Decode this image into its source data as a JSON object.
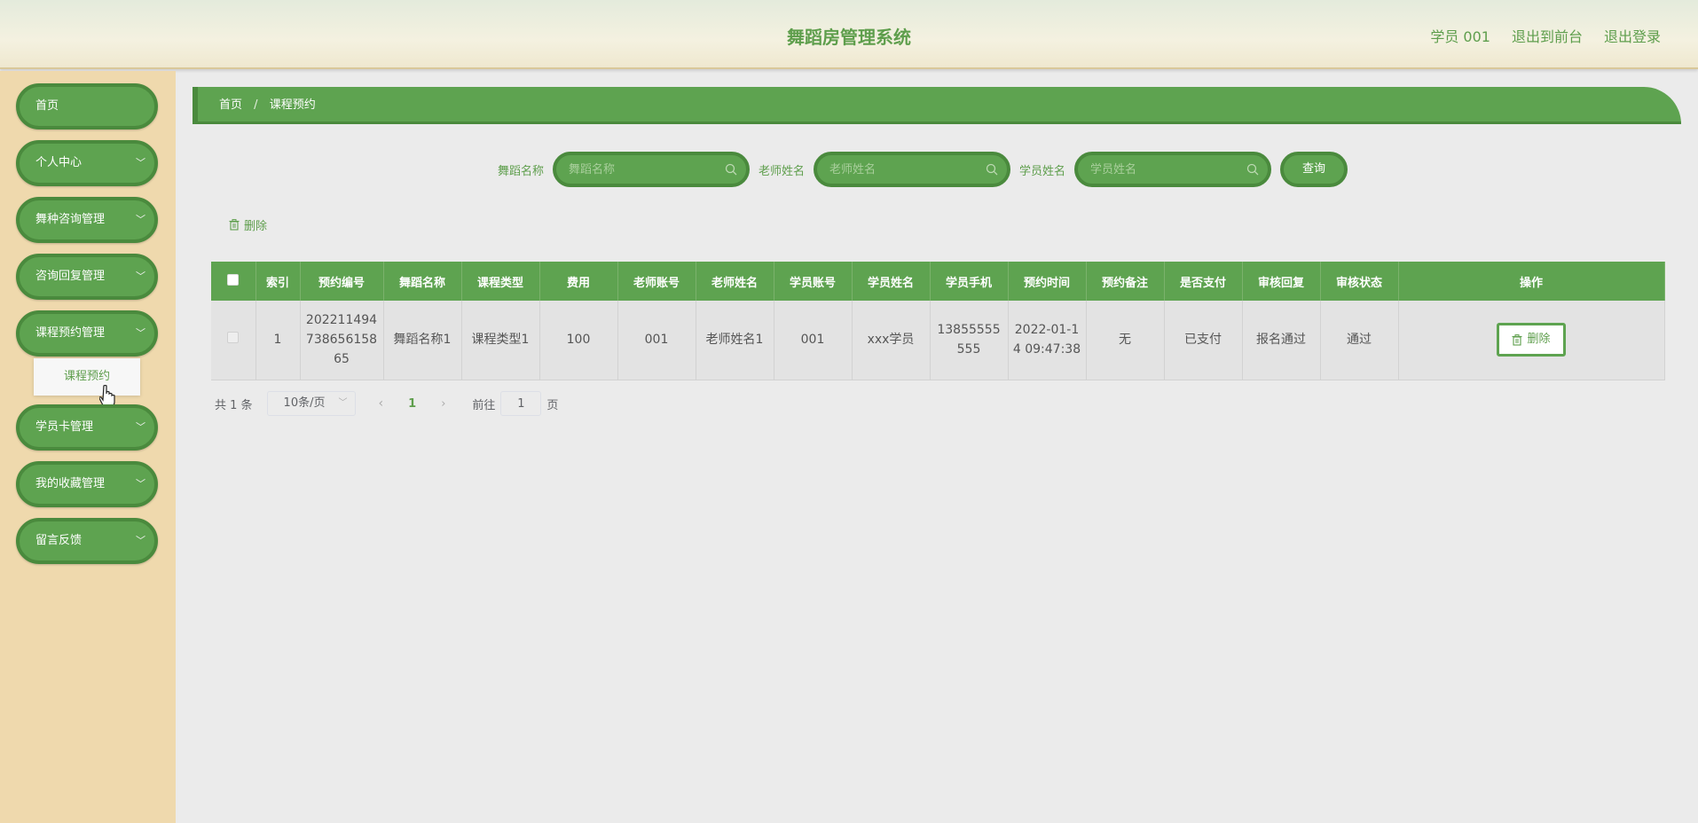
{
  "header": {
    "title": "舞蹈房管理系统",
    "links": [
      "学员 001",
      "退出到前台",
      "退出登录"
    ]
  },
  "sidebar": {
    "items": [
      {
        "label": "首页",
        "has_children": false
      },
      {
        "label": "个人中心",
        "has_children": true
      },
      {
        "label": "舞种咨询管理",
        "has_children": true
      },
      {
        "label": "咨询回复管理",
        "has_children": true
      },
      {
        "label": "课程预约管理",
        "has_children": true
      },
      {
        "label": "学员卡管理",
        "has_children": true
      },
      {
        "label": "我的收藏管理",
        "has_children": true
      },
      {
        "label": "留言反馈",
        "has_children": true
      }
    ],
    "open_submenu": {
      "label": "课程预约"
    }
  },
  "breadcrumb": {
    "home": "首页",
    "separator": "/",
    "current": "课程预约"
  },
  "search": {
    "dance_label": "舞蹈名称",
    "dance_placeholder": "舞蹈名称",
    "teacher_label": "老师姓名",
    "teacher_placeholder": "老师姓名",
    "student_label": "学员姓名",
    "student_placeholder": "学员姓名",
    "query_button": "查询"
  },
  "actions": {
    "batch_delete": "删除"
  },
  "table": {
    "headers": [
      "索引",
      "预约编号",
      "舞蹈名称",
      "课程类型",
      "费用",
      "老师账号",
      "老师姓名",
      "学员账号",
      "学员姓名",
      "学员手机",
      "预约时间",
      "预约备注",
      "是否支付",
      "审核回复",
      "审核状态",
      "操作"
    ],
    "rows": [
      {
        "cells": [
          "1",
          "2022114947386561586​5",
          "舞蹈名称1",
          "课程类型1",
          "100",
          "001",
          "老师姓名1",
          "001",
          "xxx学员",
          "13855555555",
          "2022-01-14 09:47:38",
          "无",
          "已支付",
          "报名通过",
          "通过"
        ],
        "delete_label": "删除"
      }
    ]
  },
  "pagination": {
    "total_text": "共 1 条",
    "page_size": "10条/页",
    "current_page": "1",
    "goto_label": "前往",
    "goto_value": "1",
    "goto_suffix": "页"
  },
  "colors": {
    "primary": "#5ea350",
    "primary_dark": "#4a8a3d",
    "sidebar_bg": "#efd9ad",
    "content_bg": "#ebebeb"
  }
}
